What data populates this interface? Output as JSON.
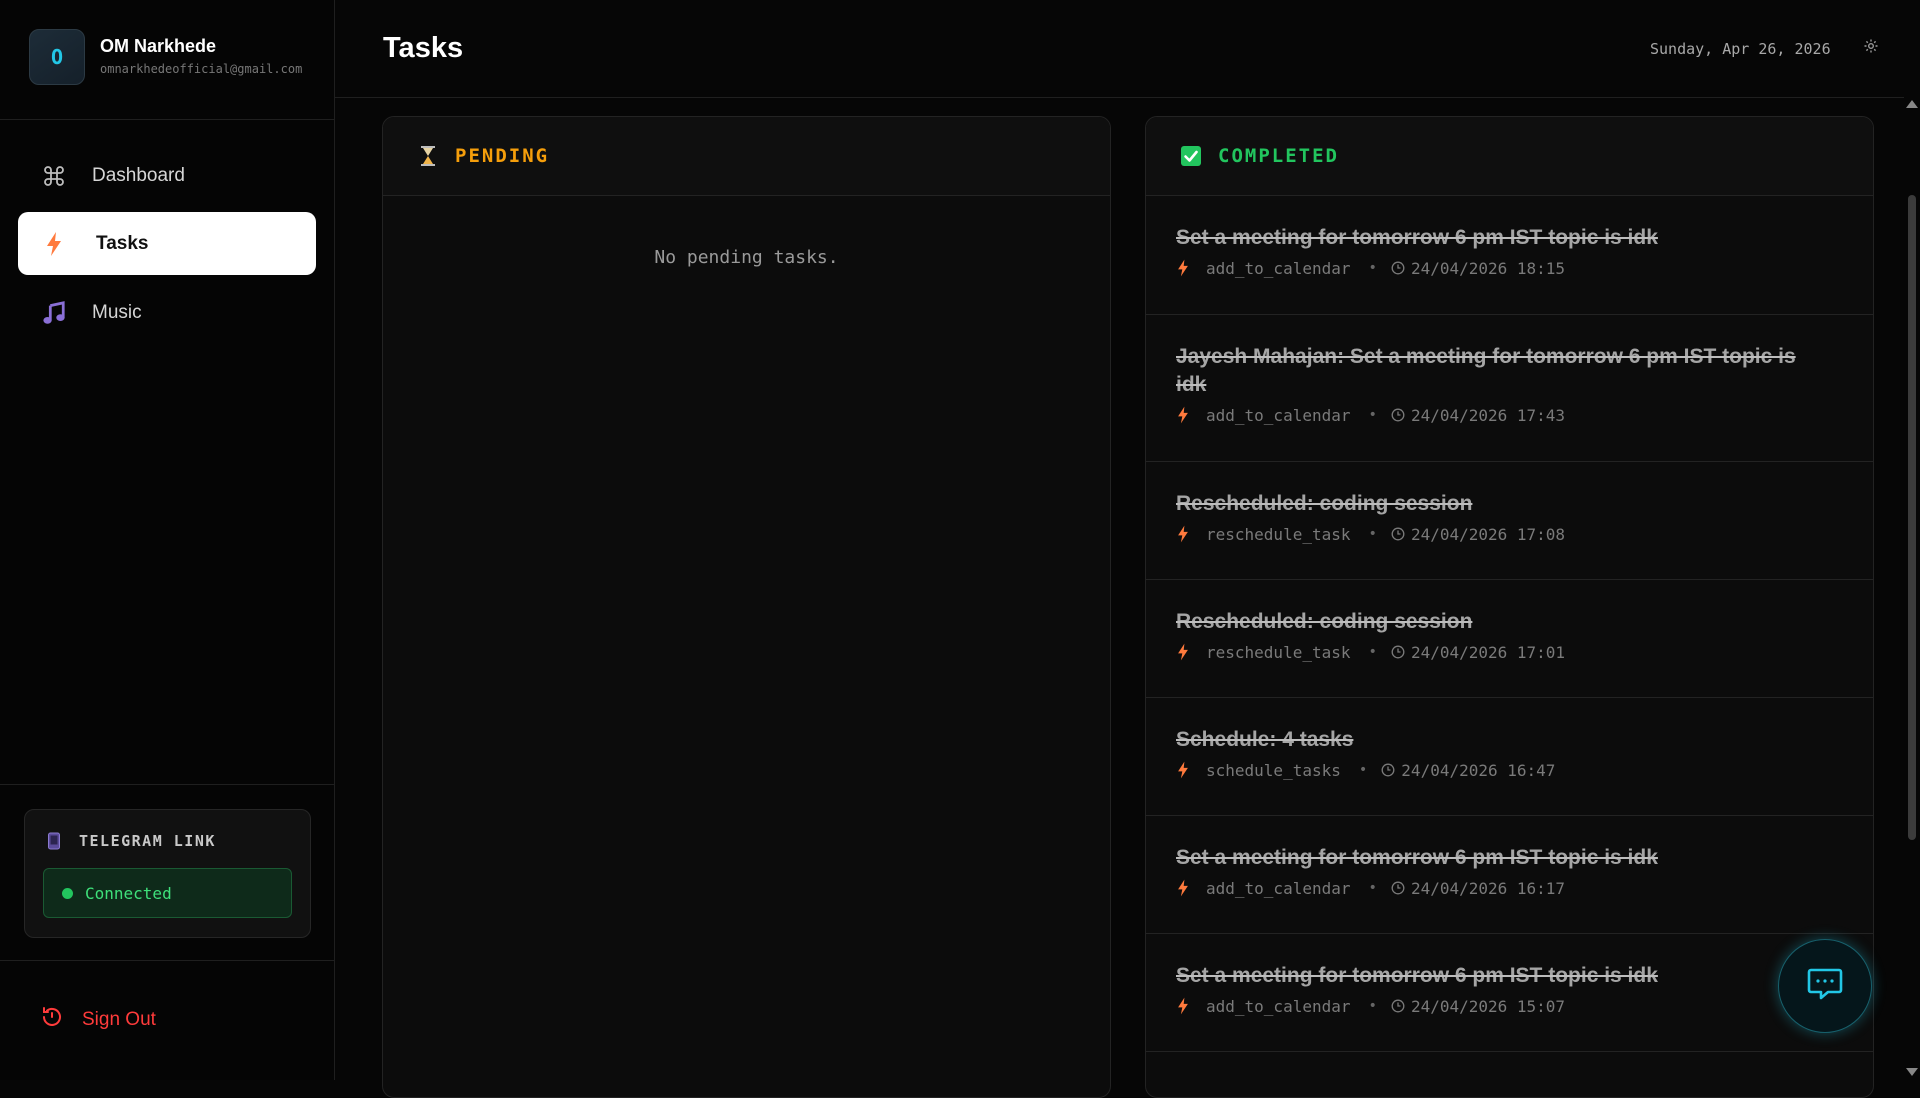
{
  "profile": {
    "initial": "O",
    "name": "OM Narkhede",
    "email": "omnarkhedeofficial@gmail.com"
  },
  "nav": {
    "items": [
      {
        "label": "Dashboard",
        "icon": "command-icon",
        "active": false
      },
      {
        "label": "Tasks",
        "icon": "bolt-icon",
        "active": true
      },
      {
        "label": "Music",
        "icon": "music-note-icon",
        "active": false
      }
    ]
  },
  "telegram": {
    "title": "TELEGRAM LINK",
    "status": "Connected",
    "status_color": "#22c55e"
  },
  "signout": {
    "label": "Sign Out",
    "color": "#ff3b3b"
  },
  "header": {
    "title": "Tasks",
    "date": "Sunday, Apr 26, 2026"
  },
  "pending": {
    "title": "PENDING",
    "color": "#f59e0b",
    "empty_message": "No pending tasks."
  },
  "completed": {
    "title": "COMPLETED",
    "color": "#22c55e",
    "tasks": [
      {
        "title": "Set a meeting for tomorrow 6 pm IST topic is idk",
        "action": "add_to_calendar",
        "time": "24/04/2026 18:15"
      },
      {
        "title": "Jayesh Mahajan: Set a meeting for tomorrow 6 pm IST topic is idk",
        "action": "add_to_calendar",
        "time": "24/04/2026 17:43"
      },
      {
        "title": "Rescheduled: coding session",
        "action": "reschedule_task",
        "time": "24/04/2026 17:08"
      },
      {
        "title": "Rescheduled: coding session",
        "action": "reschedule_task",
        "time": "24/04/2026 17:01"
      },
      {
        "title": "Schedule: 4 tasks",
        "action": "schedule_tasks",
        "time": "24/04/2026 16:47"
      },
      {
        "title": "Set a meeting for tomorrow 6 pm IST topic is idk",
        "action": "add_to_calendar",
        "time": "24/04/2026 16:17"
      },
      {
        "title": "Set a meeting for tomorrow 6 pm IST topic is idk",
        "action": "add_to_calendar",
        "time": "24/04/2026 15:07"
      }
    ]
  },
  "colors": {
    "accent_cyan": "#22c7e6",
    "bolt_orange": "#ff7a3d"
  }
}
